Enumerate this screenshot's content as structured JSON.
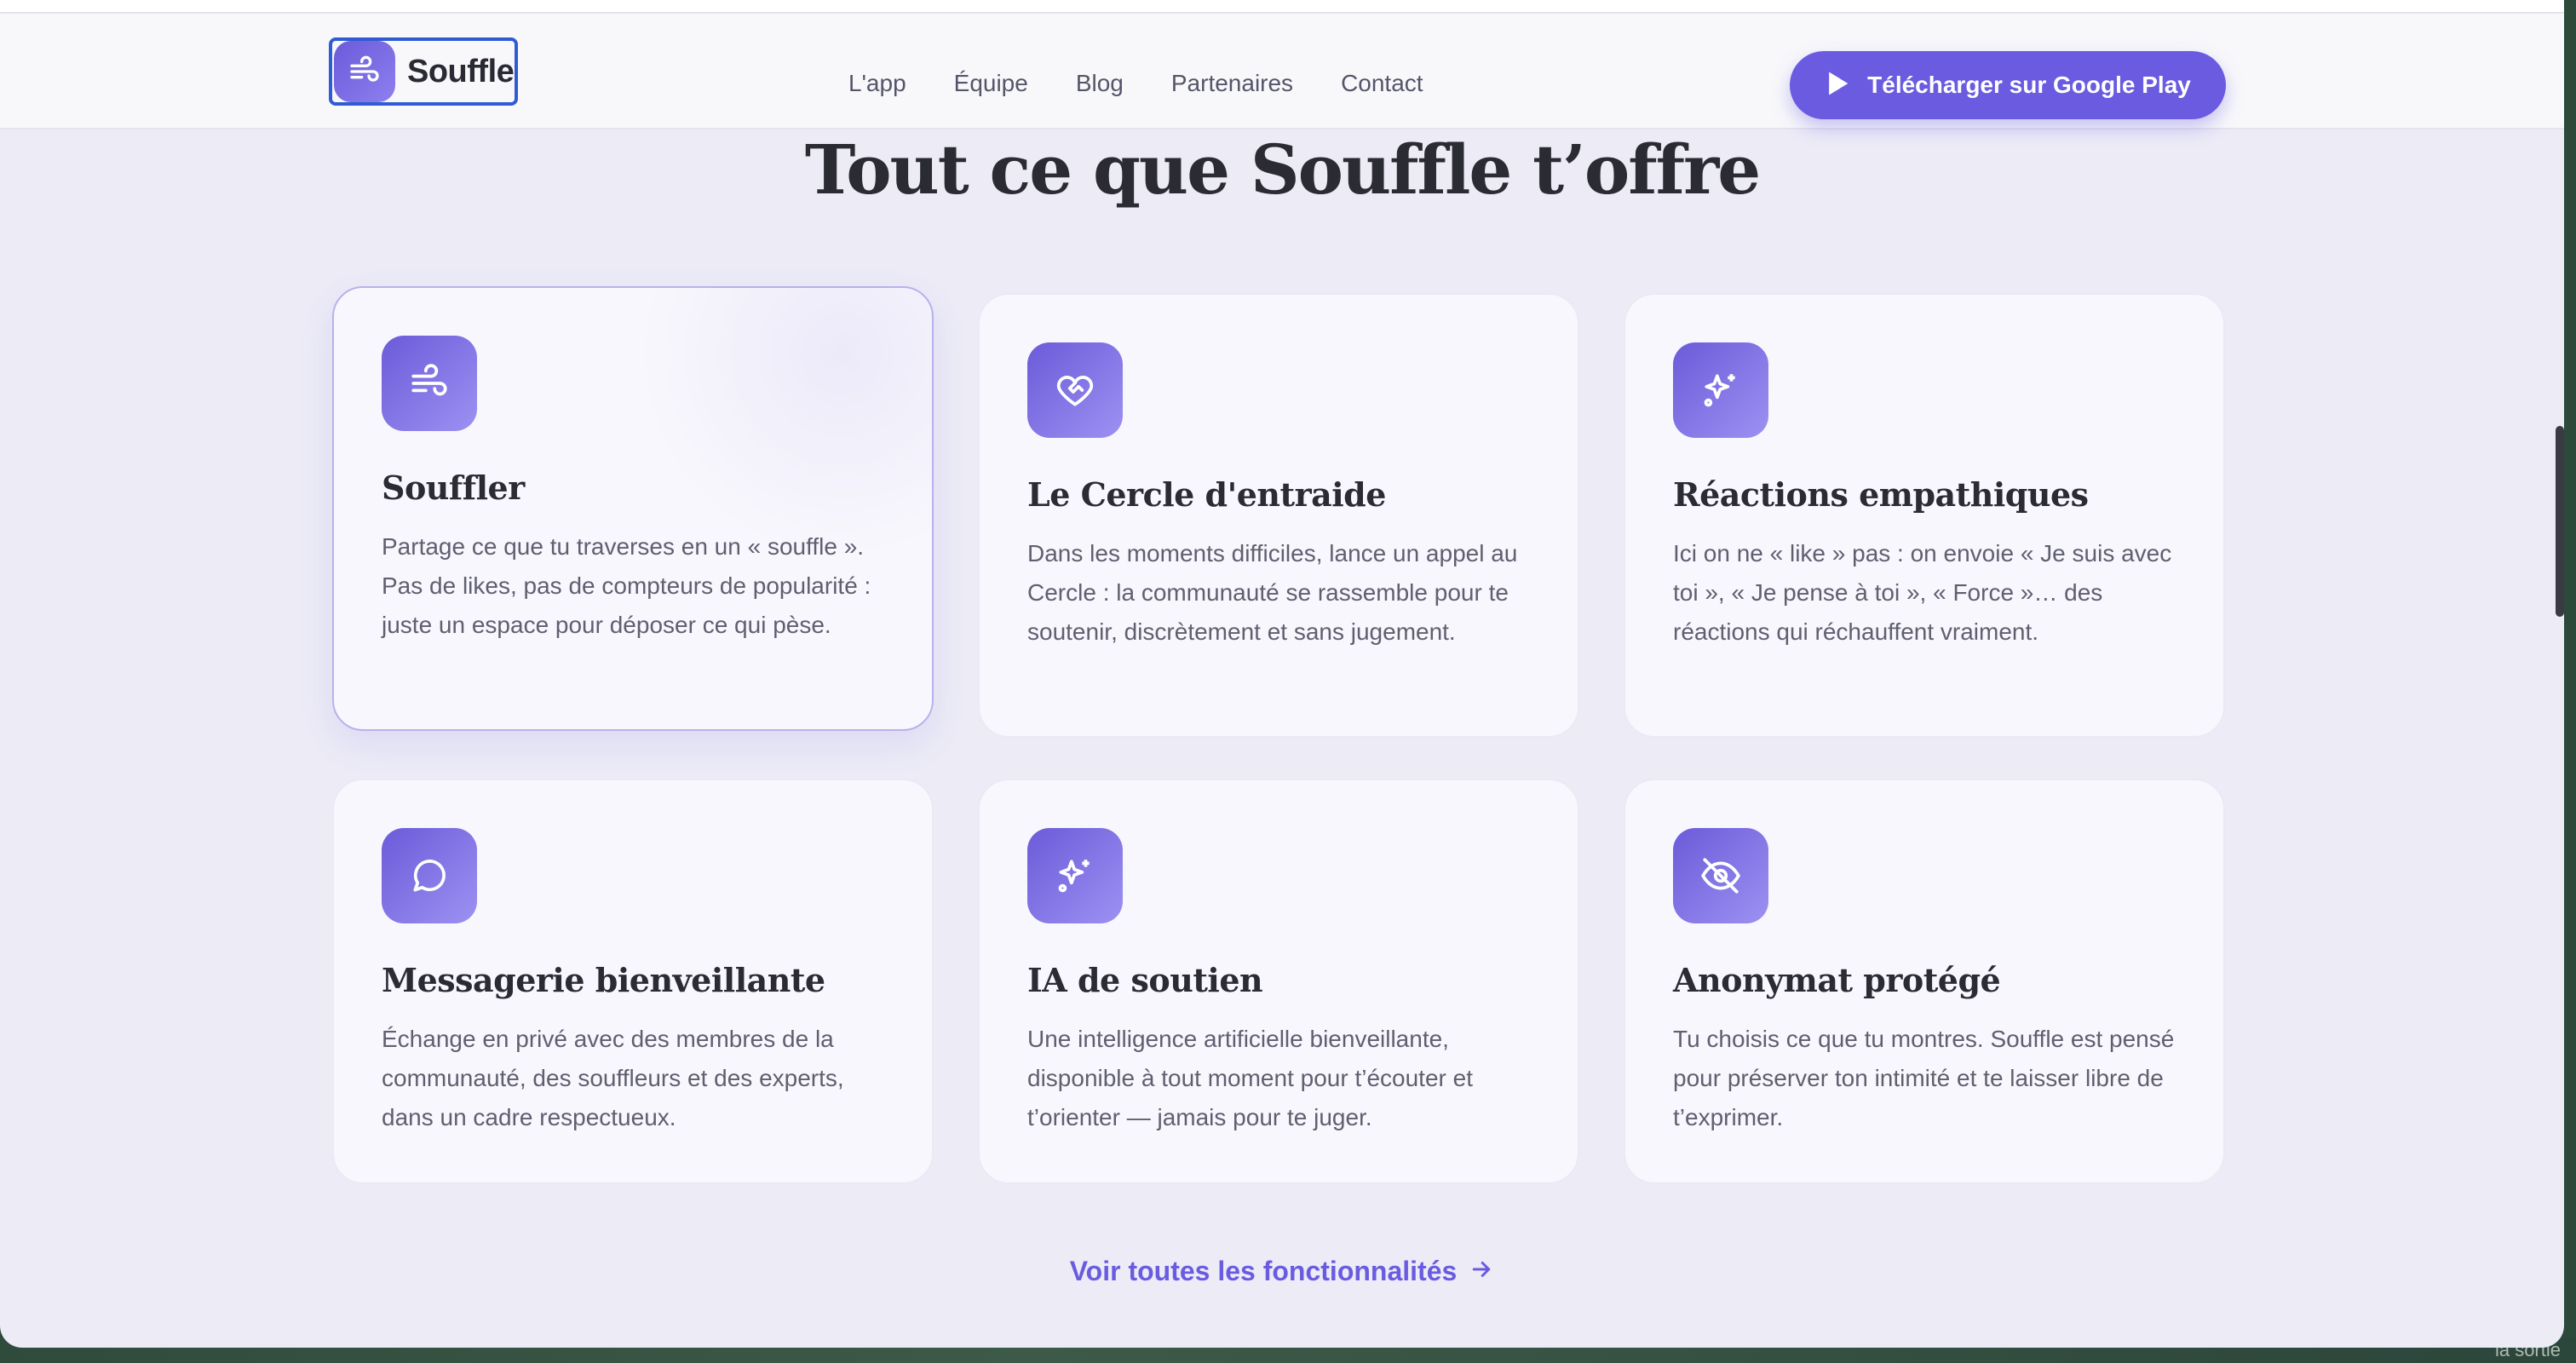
{
  "brand": {
    "name": "Souffle",
    "icon": "wind-icon"
  },
  "nav": {
    "links": [
      "L'app",
      "Équipe",
      "Blog",
      "Partenaires",
      "Contact"
    ],
    "cta_label": "Télécharger sur Google Play",
    "cta_icon": "play-icon"
  },
  "section": {
    "heading": "Tout ce que Souffle t’offre",
    "more_link": "Voir toutes les fonctionnalités",
    "more_icon": "arrow-right-icon"
  },
  "features": [
    {
      "title": "Souffler",
      "icon": "wind-icon",
      "desc": "Partage ce que tu traverses en un « souffle ». Pas de likes, pas de compteurs de popularité : juste un espace pour déposer ce qui pèse."
    },
    {
      "title": "Le Cercle d'entraide",
      "icon": "heart-handshake-icon",
      "desc": "Dans les moments difficiles, lance un appel au Cercle : la communauté se rassemble pour te soutenir, discrètement et sans jugement."
    },
    {
      "title": "Réactions empathiques",
      "icon": "sparkles-icon",
      "desc": "Ici on ne « like » pas : on envoie « Je suis avec toi », « Je pense à toi », « Force »… des réactions qui réchauffent vraiment."
    },
    {
      "title": "Messagerie bienveillante",
      "icon": "message-circle-icon",
      "desc": "Échange en privé avec des membres de la communauté, des souffleurs et des experts, dans un cadre respectueux."
    },
    {
      "title": "IA de soutien",
      "icon": "sparkles-icon",
      "desc": "Une intelligence artificielle bienveillante, disponible à tout moment pour t’écouter et t’orienter — jamais pour te juger."
    },
    {
      "title": "Anonymat protégé",
      "icon": "eye-off-icon",
      "desc": "Tu choisis ce que tu montres. Souffle est pensé pour préserver ton intimité et te laisser libre de t’exprimer."
    }
  ],
  "desktop": {
    "partial_text": "la sortie"
  },
  "colors": {
    "accent": "#6a5be0",
    "background": "#ecebf6",
    "card": "#f8f7fd"
  }
}
